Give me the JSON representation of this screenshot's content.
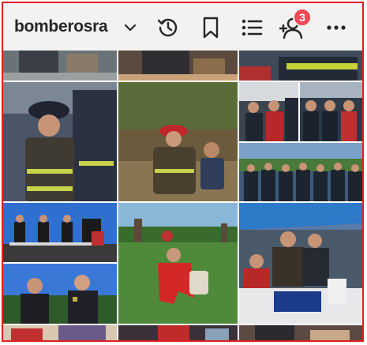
{
  "header": {
    "username": "bomberosra",
    "notification_count": "3",
    "icons": [
      "chevron-down-icon",
      "history-icon",
      "bookmark-icon",
      "list-icon",
      "add-user-icon",
      "more-icon"
    ]
  },
  "grid": {
    "tiles": [
      "partial-top-row-photo-1",
      "partial-top-row-photo-2",
      "partial-top-row-photo-3",
      "child-firefighter-photo",
      "firefighter-kneeling-with-child-photo",
      "firefighters-group-photo-1",
      "firefighters-group-photo-2",
      "officers-on-truck-photo",
      "firefighter-in-red-kneeling-photo",
      "event-booth-photo",
      "partial-bottom-row-photo-1",
      "partial-bottom-row-photo-2",
      "partial-bottom-row-photo-3"
    ]
  },
  "colors": {
    "frame": "#e02020",
    "topbar": "#f2f2f2",
    "badge": "#ed4956"
  }
}
